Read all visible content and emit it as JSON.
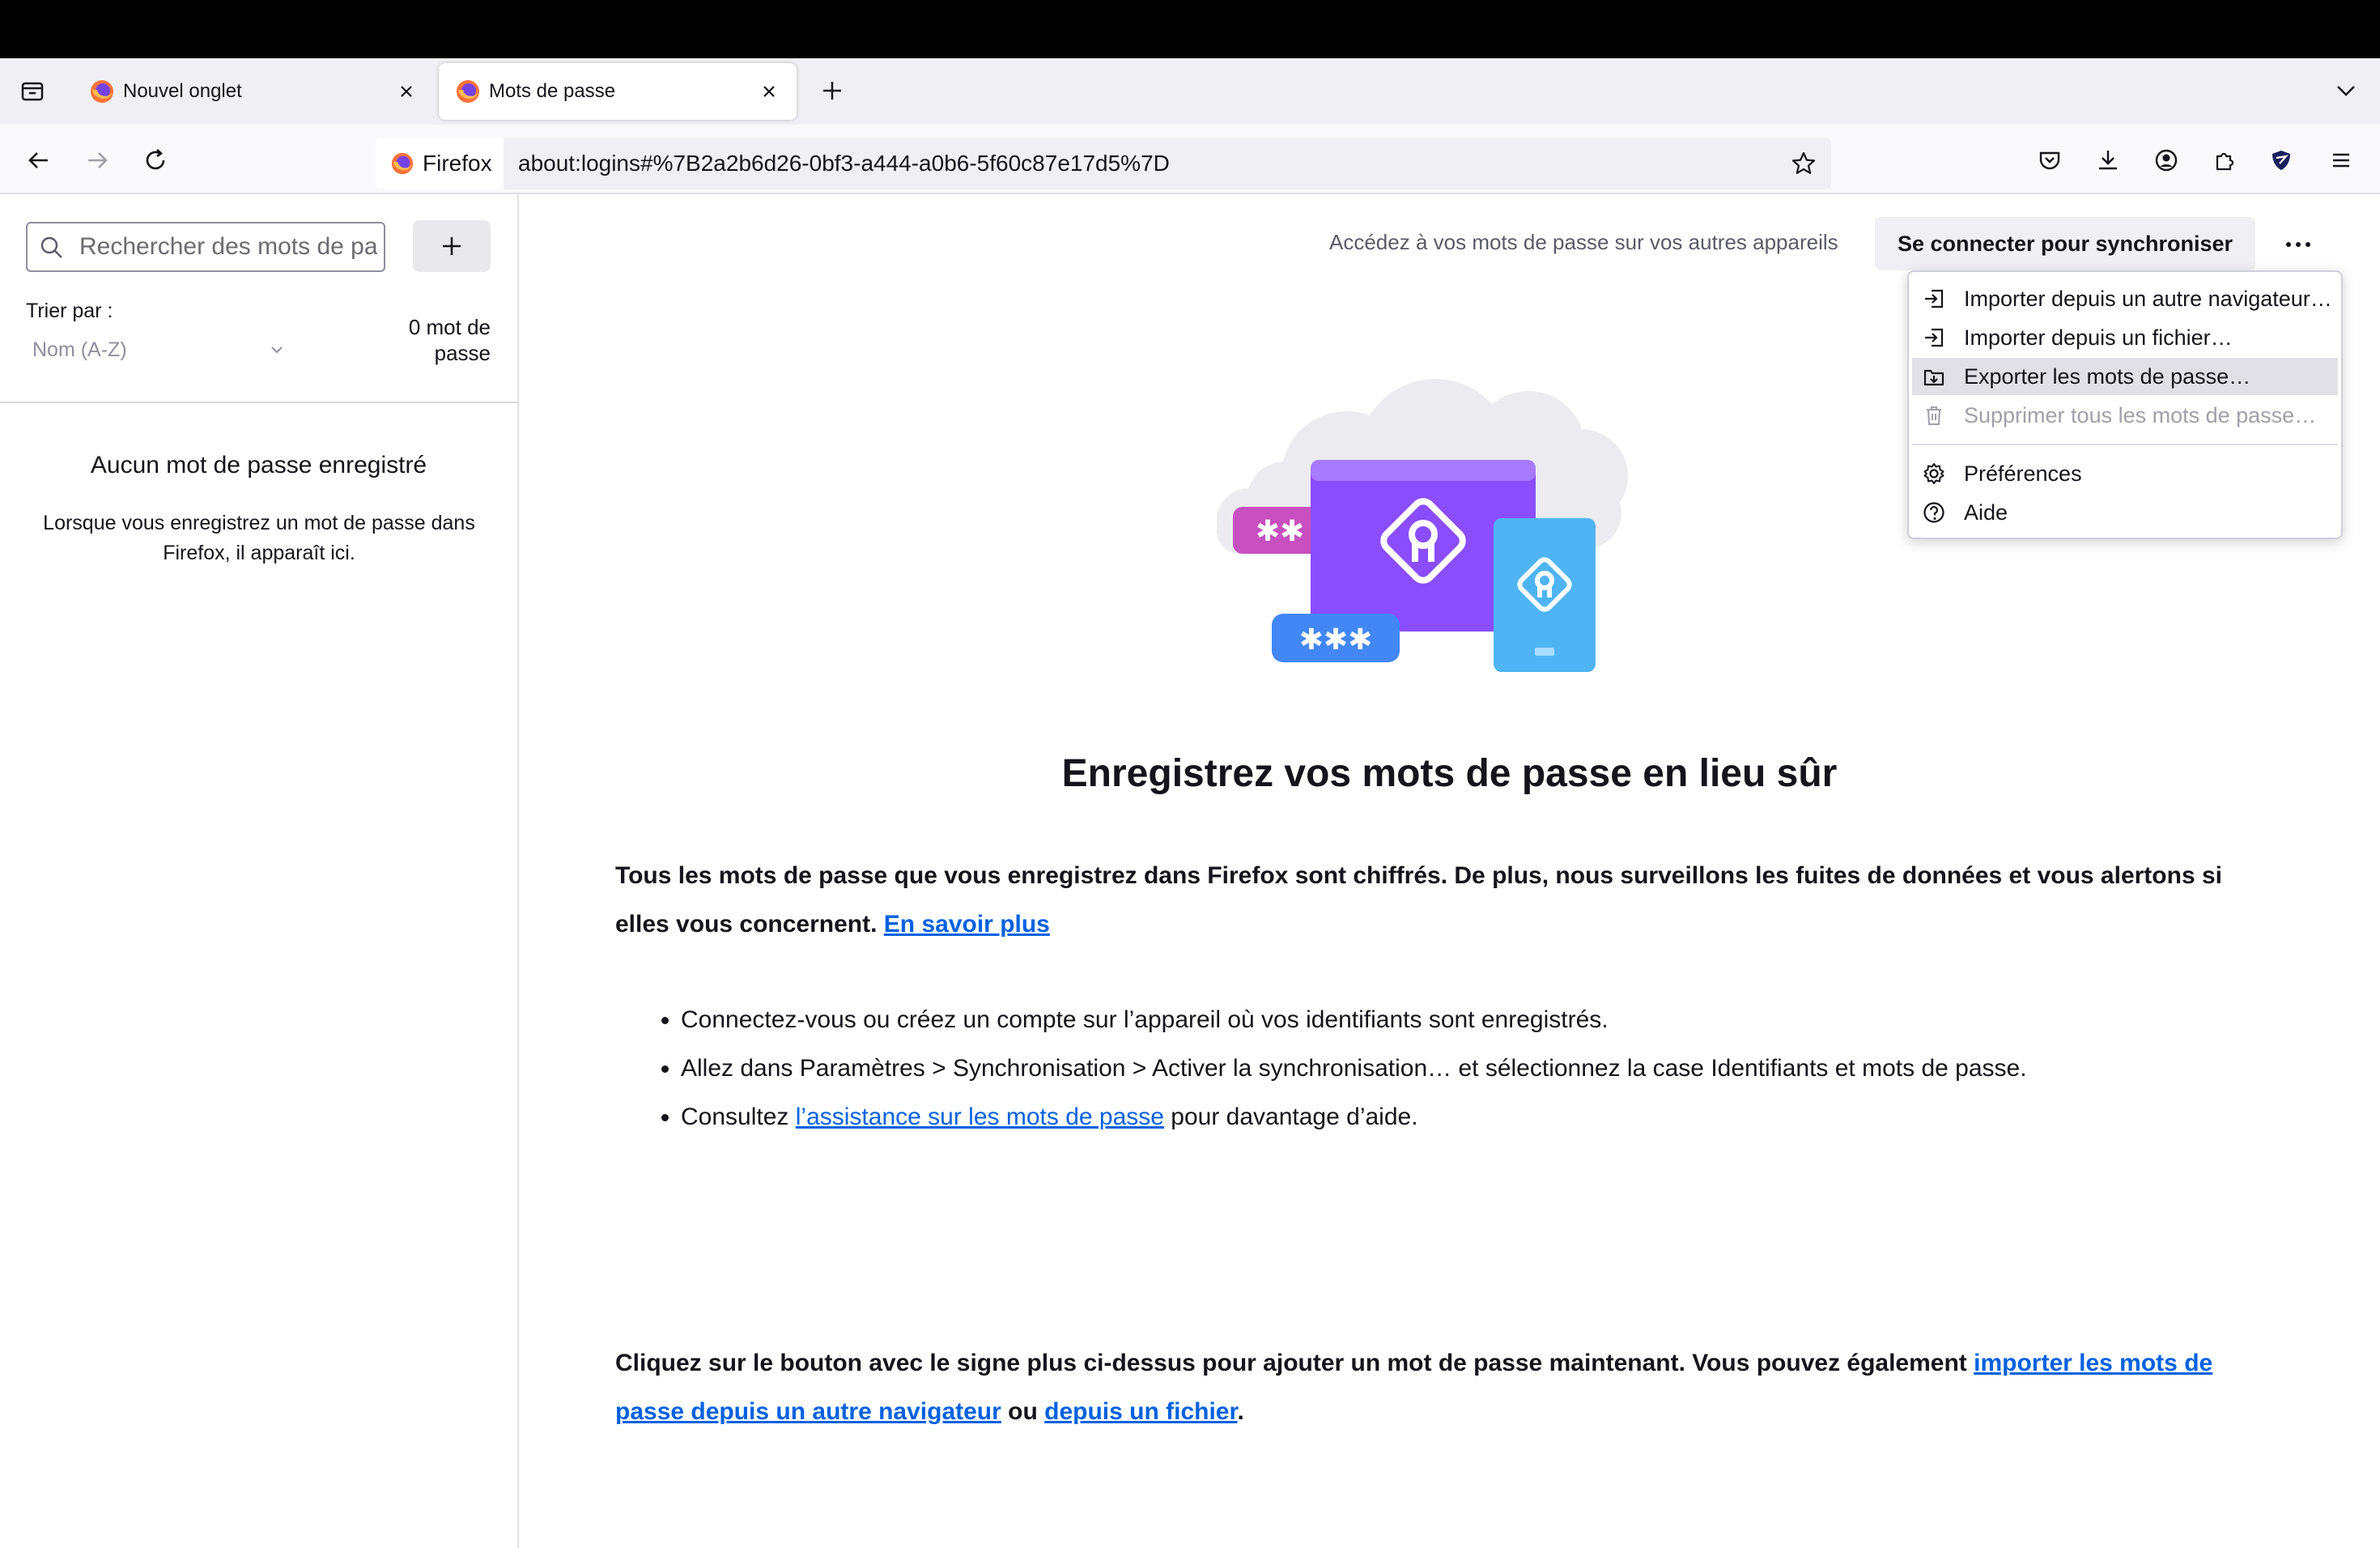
{
  "tabs": [
    {
      "title": "Nouvel onglet",
      "favicon": "firefox-icon",
      "active": false
    },
    {
      "title": "Mots de passe",
      "favicon": "firefox-icon",
      "active": true
    }
  ],
  "navbar": {
    "identity_label": "Firefox",
    "url": "about:logins#%7B2a2b6d26-0bf3-a444-a0b6-5f60c87e17d5%7D"
  },
  "sidebar": {
    "search_placeholder": "Rechercher des mots de passe",
    "add_label": "+",
    "sort_label": "Trier par :",
    "sort_value": "Nom (A-Z)",
    "count_line1": "0 mot de",
    "count_line2": "passe",
    "empty_title": "Aucun mot de passe enregistré",
    "empty_desc": "Lorsque vous enregistrez un mot de passe dans Firefox, il apparaît ici."
  },
  "main": {
    "sync_prompt": "Accédez à vos mots de passe sur vos autres appareils",
    "sync_button": "Se connecter pour synchroniser",
    "heading": "Enregistrez vos mots de passe en lieu sûr",
    "intro": "Tous les mots de passe que vous enregistrez dans Firefox sont chiffrés. De plus, nous surveillons les fuites de données et vous alertons si elles vous concernent.",
    "learn_more": "En savoir plus",
    "bullet1": "Connectez-vous ou créez un compte sur l’appareil où vos identifiants sont enregistrés.",
    "bullet2": "Allez dans Paramètres > Synchronisation > Activer la synchronisation… et sélectionnez la case Identifiants et mots de passe.",
    "bullet3_pre": "Consultez ",
    "bullet3_link": "l’assistance sur les mots de passe",
    "bullet3_post": " pour davantage d’aide.",
    "outro_pre": "Cliquez sur le bouton avec le signe plus ci-dessus pour ajouter un mot de passe maintenant. Vous pouvez également ",
    "outro_link1": "importer les mots de passe depuis un autre navigateur",
    "outro_mid": " ou ",
    "outro_link2": "depuis un fichier",
    "outro_post": "."
  },
  "menu": {
    "items": [
      {
        "label": "Importer depuis un autre navigateur…",
        "icon": "import-icon",
        "highlighted": false,
        "disabled": false
      },
      {
        "label": "Importer depuis un fichier…",
        "icon": "import-icon",
        "highlighted": false,
        "disabled": false
      },
      {
        "label": "Exporter les mots de passe…",
        "icon": "export-icon",
        "highlighted": true,
        "disabled": false
      },
      {
        "label": "Supprimer tous les mots de passe…",
        "icon": "trash-icon",
        "highlighted": false,
        "disabled": true
      },
      {
        "label": "Préférences",
        "icon": "gear-icon",
        "highlighted": false,
        "disabled": false
      },
      {
        "label": "Aide",
        "icon": "help-icon",
        "highlighted": false,
        "disabled": false
      }
    ]
  },
  "colors": {
    "link": "#0061e0",
    "illustration_purple": "#8a4dff",
    "illustration_blue": "#4fb4f3",
    "illustration_pink": "#c850c0"
  }
}
